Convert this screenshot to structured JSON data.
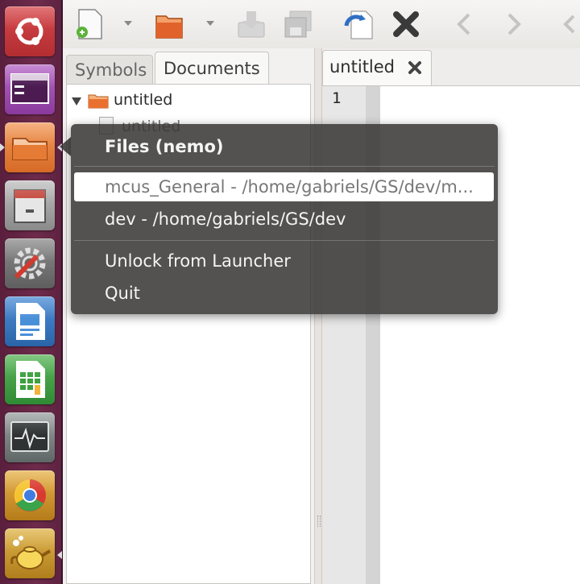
{
  "sidebar": {
    "tabs": [
      {
        "label": "Symbols"
      },
      {
        "label": "Documents"
      }
    ],
    "tree": {
      "folder_label": "untitled",
      "child_label": "untitled"
    }
  },
  "editor": {
    "tab_label": "untitled",
    "line_numbers": [
      "1"
    ]
  },
  "quicklist": {
    "title": "Files (nemo)",
    "items": [
      {
        "label": "mcus_General - /home/gabriels/GS/dev/m..."
      },
      {
        "label": "dev - /home/gabriels/GS/dev"
      },
      {
        "label": "Unlock from Launcher"
      },
      {
        "label": "Quit"
      }
    ]
  },
  "launcher": {
    "items": [
      {
        "icon": "ubuntu-dash-icon"
      },
      {
        "icon": "workspace-switcher-icon"
      },
      {
        "icon": "files-folder-icon"
      },
      {
        "icon": "file-cabinet-icon"
      },
      {
        "icon": "system-settings-icon"
      },
      {
        "icon": "libreoffice-writer-icon"
      },
      {
        "icon": "libreoffice-calc-icon"
      },
      {
        "icon": "system-monitor-icon"
      },
      {
        "icon": "chrome-browser-icon"
      },
      {
        "icon": "geany-teapot-icon"
      }
    ]
  },
  "colors": {
    "launcher_bg": "#6e2b4b",
    "popup_bg": "#373534",
    "highlight": "#ffffff"
  }
}
